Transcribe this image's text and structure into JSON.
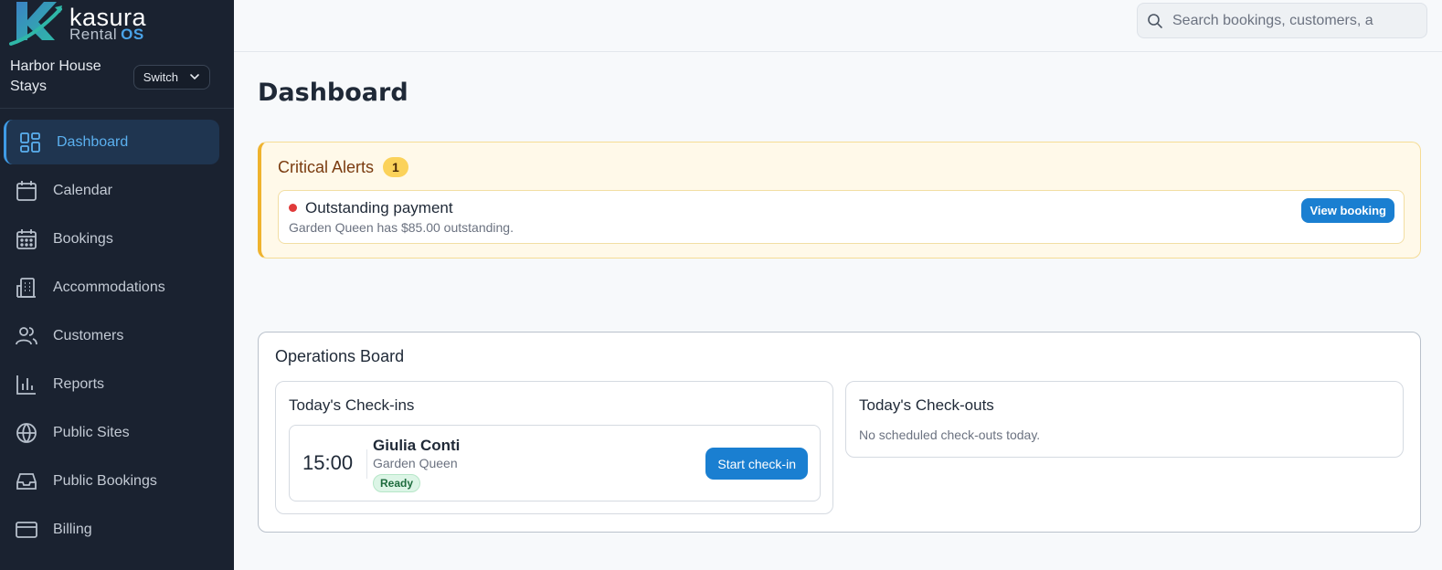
{
  "brand": {
    "name": "kasura",
    "sub": "Rental",
    "sub_accent": "OS"
  },
  "property": {
    "name": "Harbor House Stays",
    "switch_label": "Switch"
  },
  "nav": [
    {
      "label": "Dashboard",
      "icon": "dashboard-icon",
      "active": true
    },
    {
      "label": "Calendar",
      "icon": "calendar-icon"
    },
    {
      "label": "Bookings",
      "icon": "bookings-icon"
    },
    {
      "label": "Accommodations",
      "icon": "building-icon"
    },
    {
      "label": "Customers",
      "icon": "users-icon"
    },
    {
      "label": "Reports",
      "icon": "bar-chart-icon"
    },
    {
      "label": "Public Sites",
      "icon": "globe-icon"
    },
    {
      "label": "Public Bookings",
      "icon": "inbox-icon"
    },
    {
      "label": "Billing",
      "icon": "credit-card-icon"
    }
  ],
  "search": {
    "placeholder": "Search bookings, customers, a"
  },
  "page": {
    "title": "Dashboard"
  },
  "alerts": {
    "title": "Critical Alerts",
    "count": "1",
    "items": [
      {
        "title": "Outstanding payment",
        "detail": "Garden Queen has $85.00 outstanding.",
        "action": "View booking"
      }
    ]
  },
  "operations": {
    "title": "Operations Board",
    "checkins": {
      "title": "Today's Check-ins",
      "items": [
        {
          "time": "15:00",
          "guest": "Giulia Conti",
          "accommodation": "Garden Queen",
          "status": "Ready",
          "action": "Start check-in"
        }
      ]
    },
    "checkouts": {
      "title": "Today's Check-outs",
      "empty": "No scheduled check-outs today."
    }
  },
  "colors": {
    "sidebar_bg": "#1a2230",
    "accent": "#1a7fd1",
    "alert_border": "#efb32e",
    "alert_dot": "#e03a3a",
    "ready_badge": "#dcf5e6"
  }
}
